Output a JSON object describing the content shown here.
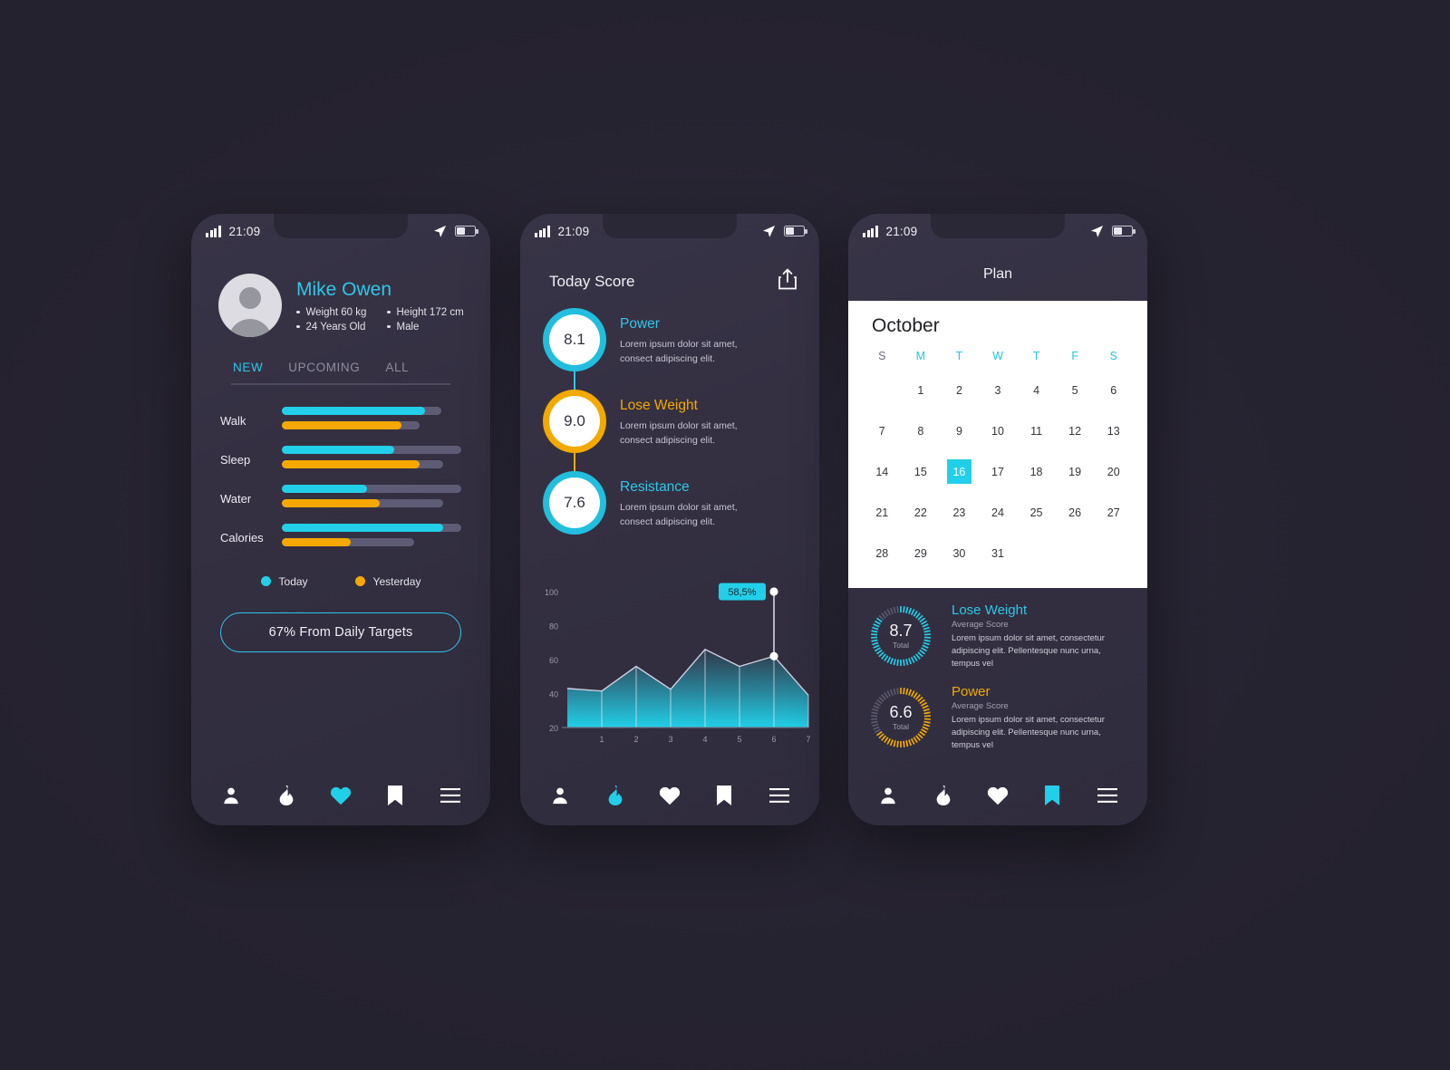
{
  "status_bar": {
    "time": "21:09",
    "signal_icon": "signal-bars-icon",
    "location_icon": "location-arrow-icon",
    "battery_icon": "battery-icon"
  },
  "screen1": {
    "profile": {
      "name": "Mike Owen",
      "avatar_icon": "avatar-placeholder-icon",
      "stats": [
        "Weight 60 kg",
        "Height 172 cm",
        "24 Years Old",
        "Male"
      ]
    },
    "tabs": [
      {
        "label": "NEW",
        "active": true
      },
      {
        "label": "UPCOMING",
        "active": false
      },
      {
        "label": "ALL",
        "active": false
      }
    ],
    "metrics": [
      {
        "label": "Walk",
        "today_track": 88,
        "today_fill": 79,
        "yesterday_track": 76,
        "yesterday_fill": 66
      },
      {
        "label": "Sleep",
        "today_track": 99,
        "today_fill": 62,
        "yesterday_track": 89,
        "yesterday_fill": 76
      },
      {
        "label": "Water",
        "today_track": 99,
        "today_fill": 47,
        "yesterday_track": 89,
        "yesterday_fill": 54
      },
      {
        "label": "Calories",
        "today_track": 99,
        "today_fill": 89,
        "yesterday_track": 73,
        "yesterday_fill": 38
      }
    ],
    "legend": [
      {
        "label": "Today",
        "color": "#22cfe8"
      },
      {
        "label": "Yesterday",
        "color": "#f7a800"
      }
    ],
    "cta_label": "67% From Daily Targets",
    "nav": [
      {
        "icon": "person-icon",
        "active": false
      },
      {
        "icon": "flame-icon",
        "active": false
      },
      {
        "icon": "heart-icon",
        "active": true
      },
      {
        "icon": "bookmark-icon",
        "active": false
      },
      {
        "icon": "menu-icon",
        "active": false
      }
    ]
  },
  "screen2": {
    "title": "Today Score",
    "share_icon": "share-icon",
    "scores": [
      {
        "value": "8.1",
        "title": "Power",
        "color": "cyan",
        "desc": "Lorem ipsum dolor sit amet, consect adipiscing elit."
      },
      {
        "value": "9.0",
        "title": "Lose Weight",
        "color": "orange",
        "desc": "Lorem ipsum dolor sit amet, consect adipiscing elit."
      },
      {
        "value": "7.6",
        "title": "Resistance",
        "color": "cyan",
        "desc": "Lorem ipsum dolor sit amet, consect adipiscing elit."
      }
    ],
    "nav": [
      {
        "icon": "person-icon",
        "active": false
      },
      {
        "icon": "flame-icon",
        "active": true
      },
      {
        "icon": "heart-icon",
        "active": false
      },
      {
        "icon": "bookmark-icon",
        "active": false
      },
      {
        "icon": "menu-icon",
        "active": false
      }
    ]
  },
  "screen3": {
    "title": "Plan",
    "calendar": {
      "month": "October",
      "dow": [
        "S",
        "M",
        "T",
        "W",
        "T",
        "F",
        "S"
      ],
      "lead_blanks": 1,
      "days": [
        1,
        2,
        3,
        4,
        5,
        6,
        7,
        8,
        9,
        10,
        11,
        12,
        13,
        14,
        15,
        16,
        17,
        18,
        19,
        20,
        21,
        22,
        23,
        24,
        25,
        26,
        27,
        28,
        29,
        30,
        31
      ],
      "selected_day": 16
    },
    "averages": [
      {
        "value": "8.7",
        "total_label": "Total",
        "title": "Lose Weight",
        "color": "cyan",
        "subtitle": "Average Score",
        "desc": "Lorem ipsum dolor sit amet, consectetur adipiscing elit. Pellentesque nunc urna, tempus vel"
      },
      {
        "value": "6.6",
        "total_label": "Total",
        "title": "Power",
        "color": "orange",
        "subtitle": "Average Score",
        "desc": "Lorem ipsum dolor sit amet, consectetur adipiscing elit. Pellentesque nunc urna, tempus vel"
      }
    ],
    "nav": [
      {
        "icon": "person-icon",
        "active": false
      },
      {
        "icon": "flame-icon",
        "active": false
      },
      {
        "icon": "heart-icon",
        "active": false
      },
      {
        "icon": "bookmark-icon",
        "active": true
      },
      {
        "icon": "menu-icon",
        "active": false
      }
    ]
  },
  "chart_data": {
    "type": "area",
    "title": "",
    "x": [
      0,
      1,
      2,
      3,
      4,
      5,
      6,
      7
    ],
    "values": [
      43,
      41.5,
      56,
      42.5,
      66,
      56,
      62,
      39
    ],
    "xticks": [
      "1",
      "2",
      "3",
      "4",
      "5",
      "6",
      "7"
    ],
    "yticks": [
      20,
      40,
      60,
      80,
      100
    ],
    "ylim": [
      20,
      100
    ],
    "grid": true,
    "tooltip": {
      "label": "58,5%",
      "x_index": 6,
      "y": 100
    },
    "highlight_points": [
      {
        "x_index": 6,
        "y": 62
      },
      {
        "x_index": 6,
        "y": 100
      }
    ],
    "area_color": "#22cfe8",
    "line_color": "#cfcfe0"
  },
  "colors": {
    "cyan": "#22cfe8",
    "orange": "#f7a800",
    "bg": "#25222f",
    "card": "#343042",
    "track": "#5e5c74"
  }
}
